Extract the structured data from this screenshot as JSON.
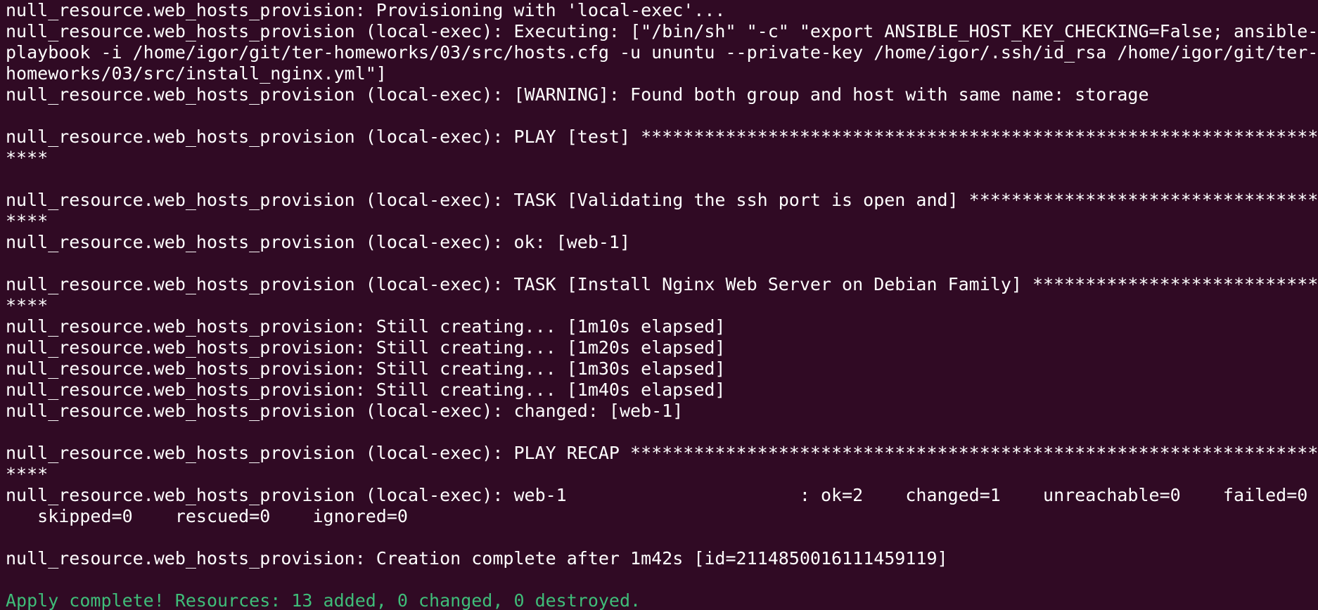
{
  "terminal": {
    "lines": [
      {
        "text": "null_resource.web_hosts_provision: Provisioning with 'local-exec'..."
      },
      {
        "text": "null_resource.web_hosts_provision (local-exec): Executing: [\"/bin/sh\" \"-c\" \"export ANSIBLE_HOST_KEY_CHECKING=False; ansible-"
      },
      {
        "text": "playbook -i /home/igor/git/ter-homeworks/03/src/hosts.cfg -u ununtu --private-key /home/igor/.ssh/id_rsa /home/igor/git/ter-"
      },
      {
        "text": "homeworks/03/src/install_nginx.yml\"]"
      },
      {
        "text": "null_resource.web_hosts_provision (local-exec): [WARNING]: Found both group and host with same name: storage"
      },
      {
        "text": ""
      },
      {
        "text": "null_resource.web_hosts_provision (local-exec): PLAY [test] *****************************************************************"
      },
      {
        "text": "****"
      },
      {
        "text": ""
      },
      {
        "text": "null_resource.web_hosts_provision (local-exec): TASK [Validating the ssh port is open and] ***********************************"
      },
      {
        "text": "****"
      },
      {
        "text": "null_resource.web_hosts_provision (local-exec): ok: [web-1]"
      },
      {
        "text": ""
      },
      {
        "text": "null_resource.web_hosts_provision (local-exec): TASK [Install Nginx Web Server on Debian Family] *****************************"
      },
      {
        "text": "****"
      },
      {
        "text": "null_resource.web_hosts_provision: Still creating... [1m10s elapsed]"
      },
      {
        "text": "null_resource.web_hosts_provision: Still creating... [1m20s elapsed]"
      },
      {
        "text": "null_resource.web_hosts_provision: Still creating... [1m30s elapsed]"
      },
      {
        "text": "null_resource.web_hosts_provision: Still creating... [1m40s elapsed]"
      },
      {
        "text": "null_resource.web_hosts_provision (local-exec): changed: [web-1]"
      },
      {
        "text": ""
      },
      {
        "text": "null_resource.web_hosts_provision (local-exec): PLAY RECAP ******************************************************************"
      },
      {
        "text": "****"
      },
      {
        "text": "null_resource.web_hosts_provision (local-exec): web-1                      : ok=2    changed=1    unreachable=0    failed=0"
      },
      {
        "text": "   skipped=0    rescued=0    ignored=0"
      },
      {
        "text": ""
      },
      {
        "text": "null_resource.web_hosts_provision: Creation complete after 1m42s [id=2114850016111459119]"
      },
      {
        "text": ""
      },
      {
        "text": "Apply complete! Resources: 13 added, 0 changed, 0 destroyed."
      }
    ]
  },
  "colors": {
    "background": "#300a24",
    "foreground": "#ffffff",
    "success": "#3fbd79"
  }
}
